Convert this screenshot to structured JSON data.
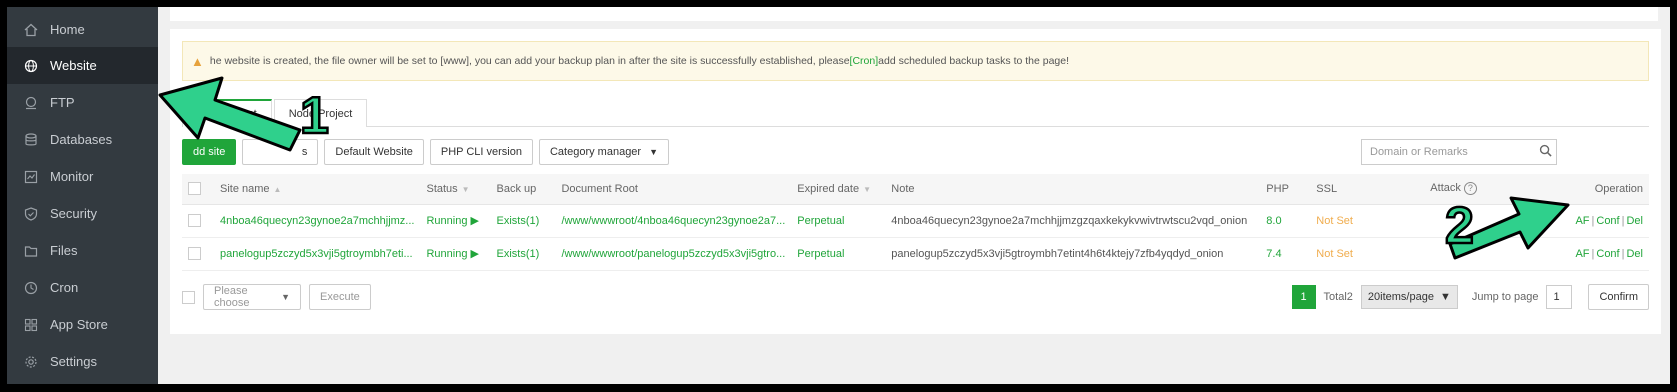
{
  "sidebar": {
    "items": [
      {
        "label": "Home",
        "icon": "home-icon"
      },
      {
        "label": "Website",
        "icon": "globe-icon"
      },
      {
        "label": "FTP",
        "icon": "ftp-icon"
      },
      {
        "label": "Databases",
        "icon": "database-icon"
      },
      {
        "label": "Monitor",
        "icon": "monitor-icon"
      },
      {
        "label": "Security",
        "icon": "shield-icon"
      },
      {
        "label": "Files",
        "icon": "folder-icon"
      },
      {
        "label": "Cron",
        "icon": "clock-icon"
      },
      {
        "label": "App Store",
        "icon": "grid-icon"
      },
      {
        "label": "Settings",
        "icon": "gear-icon"
      }
    ],
    "active": "Website"
  },
  "notice": {
    "text_before": "he website is created, the file owner will be set to [www], you can add your backup plan in after the site is successfully established, please",
    "link": "[Cron]",
    "text_after": "add scheduled backup tasks to the page!"
  },
  "tabs": [
    {
      "label": "PHP Project"
    },
    {
      "label": "Node Project"
    }
  ],
  "toolbar": {
    "add_site": "dd site",
    "modify_default": "s",
    "default_website": "Default Website",
    "php_cli": "PHP CLI version",
    "category_manager": "Category manager"
  },
  "search": {
    "placeholder": "Domain or Remarks"
  },
  "table": {
    "headers": {
      "site_name": "Site name",
      "status": "Status",
      "backup": "Back up",
      "doc_root": "Document Root",
      "expired": "Expired date",
      "note": "Note",
      "php": "PHP",
      "ssl": "SSL",
      "attack": "Attack",
      "operation": "Operation"
    },
    "rows": [
      {
        "site_name": "4nboa46quecyn23gynoe2a7mchhjjmz...",
        "status": "Running",
        "backup": "Exists(1)",
        "doc_root": "/www/wwwroot/4nboa46quecyn23gynoe2a7...",
        "expired": "Perpetual",
        "note": "4nboa46quecyn23gynoe2a7mchhjjmzgzqaxkekykvwivtrwtscu2vqd_onion",
        "php": "8.0",
        "ssl": "Not Set",
        "attack": "0",
        "op_waf": "AF",
        "op_conf": "Conf",
        "op_del": "Del"
      },
      {
        "site_name": "panelogup5zczyd5x3vji5gtroymbh7eti...",
        "status": "Running",
        "backup": "Exists(1)",
        "doc_root": "/www/wwwroot/panelogup5zczyd5x3vji5gtro...",
        "expired": "Perpetual",
        "note": "panelogup5zczyd5x3vji5gtroymbh7etint4h6t4ktejy7zfb4yqdyd_onion",
        "php": "7.4",
        "ssl": "Not Set",
        "attack": "",
        "op_waf": "AF",
        "op_conf": "Conf",
        "op_del": "Del"
      }
    ]
  },
  "footer": {
    "batch_placeholder": "Please choose",
    "execute": "Execute",
    "page_current": "1",
    "total": "Total2",
    "per_page": "20items/page",
    "jump_label": "Jump to page",
    "jump_value": "1",
    "confirm": "Confirm"
  },
  "annotations": {
    "label_1": "1",
    "label_2": "2"
  },
  "colors": {
    "sidebar_bg": "#333a40",
    "accent": "#20a53a",
    "annotation": "#2fd08c"
  }
}
